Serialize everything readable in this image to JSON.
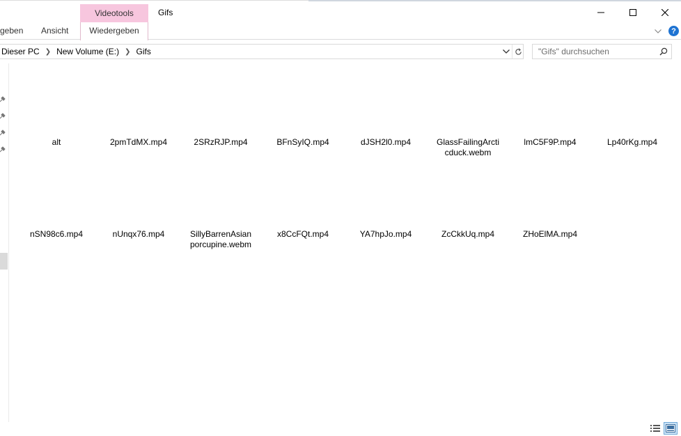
{
  "window": {
    "title": "Gifs",
    "context_tab_group": "Videotools"
  },
  "ribbon": {
    "tabs": [
      {
        "label": "geben"
      },
      {
        "label": "Ansicht"
      },
      {
        "label": "Wiedergeben"
      }
    ]
  },
  "address": {
    "path": [
      "Dieser PC",
      "New Volume (E:)",
      "Gifs"
    ]
  },
  "search": {
    "placeholder": "\"Gifs\" durchsuchen"
  },
  "files": [
    {
      "name": "alt"
    },
    {
      "name": "2pmTdMX.mp4"
    },
    {
      "name": "2SRzRJP.mp4"
    },
    {
      "name": "BFnSyIQ.mp4"
    },
    {
      "name": "dJSH2l0.mp4"
    },
    {
      "name": "GlassFailingArcticduck.webm"
    },
    {
      "name": "lmC5F9P.mp4"
    },
    {
      "name": "Lp40rKg.mp4"
    },
    {
      "name": "nSN98c6.mp4"
    },
    {
      "name": "nUnqx76.mp4"
    },
    {
      "name": "SillyBarrenAsianporcupine.webm"
    },
    {
      "name": "x8CcFQt.mp4"
    },
    {
      "name": "YA7hpJo.mp4"
    },
    {
      "name": "ZcCkkUq.mp4"
    },
    {
      "name": "ZHoElMA.mp4"
    }
  ],
  "colors": {
    "context_tab": "#f7c6de",
    "help_icon": "#1e73d2",
    "selected_view": "#cce4f7"
  }
}
